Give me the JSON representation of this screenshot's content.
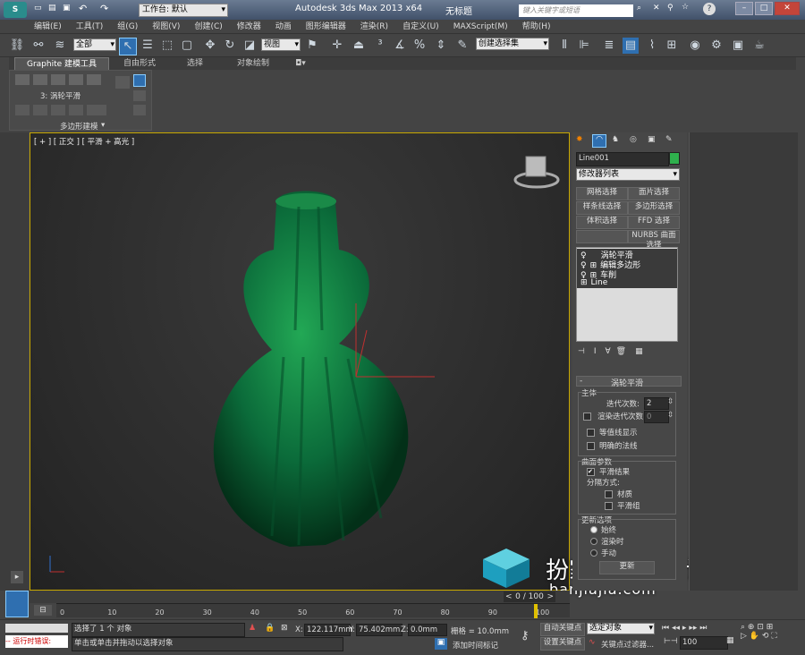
{
  "titlebar": {
    "workspace": "工作台: 默认",
    "app_title": "Autodesk 3ds Max  2013 x64",
    "doc_title": "无标题",
    "search_placeholder": "键入关键字或短语"
  },
  "menus": [
    "编辑(E)",
    "工具(T)",
    "组(G)",
    "视图(V)",
    "创建(C)",
    "修改器",
    "动画",
    "图形编辑器",
    "渲染(R)",
    "自定义(U)",
    "MAXScript(M)",
    "帮助(H)"
  ],
  "toolbar": {
    "select_filter": "全部",
    "ref_coord": "视图",
    "named_sel": "创建选择集"
  },
  "ribbon": {
    "tabs": [
      "Graphite 建模工具",
      "自由形式",
      "选择",
      "对象绘制"
    ],
    "modifier_label": "3: 涡轮平滑",
    "poly_label": "多边形建模"
  },
  "viewport": {
    "label": "[ + ] [ 正交 ] [ 平滑 + 高光 ]",
    "model_color": "#0b6b3a"
  },
  "cmd": {
    "object_name": "Line001",
    "object_color": "#2fb04d",
    "modifier_list": "修改器列表",
    "mod_buttons": [
      "网格选择",
      "面片选择",
      "样条线选择",
      "多边形选择",
      "体积选择",
      "FFD 选择",
      "",
      "NURBS 曲面选择"
    ],
    "stack": [
      "涡轮平滑",
      "编辑多边形",
      "车削",
      "Line"
    ],
    "rollout_title": "涡轮平滑",
    "main_group": "主体",
    "iterations_label": "迭代次数:",
    "iterations_value": "2",
    "render_iters_label": "渲染迭代次数:",
    "render_iters_value": "0",
    "isoline": "等值线显示",
    "explicit_normals": "明确的法线",
    "surface_group": "曲面参数",
    "smooth_result": "平滑结果",
    "separate_by": "分隔方式:",
    "materials": "材质",
    "smoothing_groups": "平滑组",
    "update_group": "更新选项",
    "always": "始终",
    "when_rendering": "渲染时",
    "manually": "手动",
    "update_btn": "更新"
  },
  "timeline": {
    "frame_display": "0 / 100",
    "ticks": [
      "0",
      "10",
      "20",
      "30",
      "40",
      "50",
      "60",
      "70",
      "80",
      "90",
      "100"
    ]
  },
  "status": {
    "selection": "选择了 1 个 对象",
    "hint": "单击或单击并拖动以选择对象",
    "script_label": "运行时错误:",
    "x_label": "X:",
    "x_value": "122.117mm",
    "y_label": "Y:",
    "y_value": "75.402mm",
    "z_label": "Z:",
    "z_value": "0.0mm",
    "grid": "栅格 = 10.0mm",
    "add_time_tag": "添加时间标记",
    "auto_key": "自动关键点",
    "set_key": "设置关键点",
    "key_target": "选定对象",
    "key_filters": "关键点过滤器...",
    "frame": "100"
  },
  "watermark": {
    "brand": "扮家家室内设计",
    "url": "banjiajia.com"
  }
}
